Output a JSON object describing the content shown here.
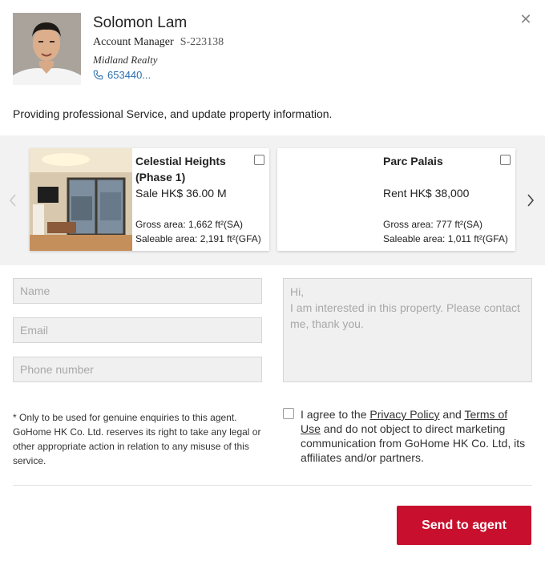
{
  "agent": {
    "name": "Solomon Lam",
    "role": "Account Manager",
    "license_id": "S-223138",
    "company": "Midland Realty",
    "phone": "653440..."
  },
  "tagline": "Providing professional Service, and update property information.",
  "listings": [
    {
      "title": "Celestial Heights (Phase 1)",
      "price": "Sale HK$ 36.00 M",
      "gross_area": "Gross area: 1,662 ft²(SA)",
      "saleable_area": "Saleable area: 2,191 ft²(GFA)",
      "checked": false
    },
    {
      "title": "Parc Palais",
      "price": "Rent HK$ 38,000",
      "gross_area": "Gross area: 777 ft²(SA)",
      "saleable_area": "Saleable area: 1,011 ft²(GFA)",
      "checked": false
    }
  ],
  "form": {
    "name_placeholder": "Name",
    "email_placeholder": "Email",
    "phone_placeholder": "Phone number",
    "message_placeholder": "Hi,\nI am interested in this property. Please contact me, thank you."
  },
  "disclaimer": "* Only to be used for genuine enquiries to this agent. GoHome HK Co. Ltd. reserves its right to take any legal or other appropriate action in relation to any misuse of this service.",
  "consent": {
    "prefix": "I agree to the ",
    "privacy_label": "Privacy Policy",
    "and": " and ",
    "terms_label": "Terms of Use",
    "suffix": " and do not object to direct marketing communication from GoHome HK Co. Ltd, its affiliates and/or partners."
  },
  "send_label": "Send to agent",
  "colors": {
    "accent": "#c8102e",
    "link": "#2a6fb0",
    "carousel_bg": "#f2f2f2"
  }
}
